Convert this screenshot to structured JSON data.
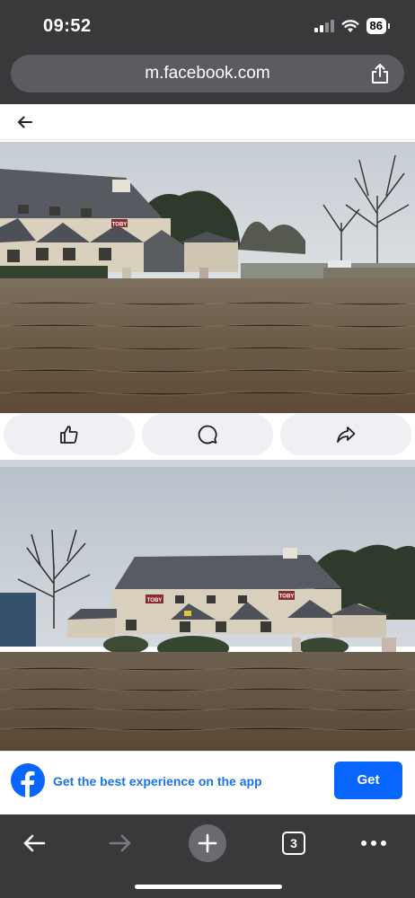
{
  "status_bar": {
    "time": "09:52",
    "battery": "86"
  },
  "url_bar": {
    "url": "m.facebook.com"
  },
  "icons": {
    "back": "back-arrow-icon",
    "like": "thumbs-up-icon",
    "comment": "comment-bubble-icon",
    "share": "share-arrow-icon",
    "browser_share": "share-box-icon",
    "browser_back": "arrow-left-icon",
    "browser_forward": "arrow-right-icon",
    "new_tab": "plus-icon",
    "menu": "more-dots-icon",
    "facebook": "facebook-logo-icon"
  },
  "photos": {
    "photo1_sign": "TOBY",
    "photo2_sign_left": "TOBY",
    "photo2_sign_right": "TOBY"
  },
  "app_banner": {
    "text": "Get the best experience on the app",
    "button_label": "Get"
  },
  "toolbar": {
    "tab_count": "3"
  },
  "colors": {
    "facebook_blue": "#0866ff",
    "banner_text": "#1b74e4",
    "chrome_dark": "#38393b"
  }
}
